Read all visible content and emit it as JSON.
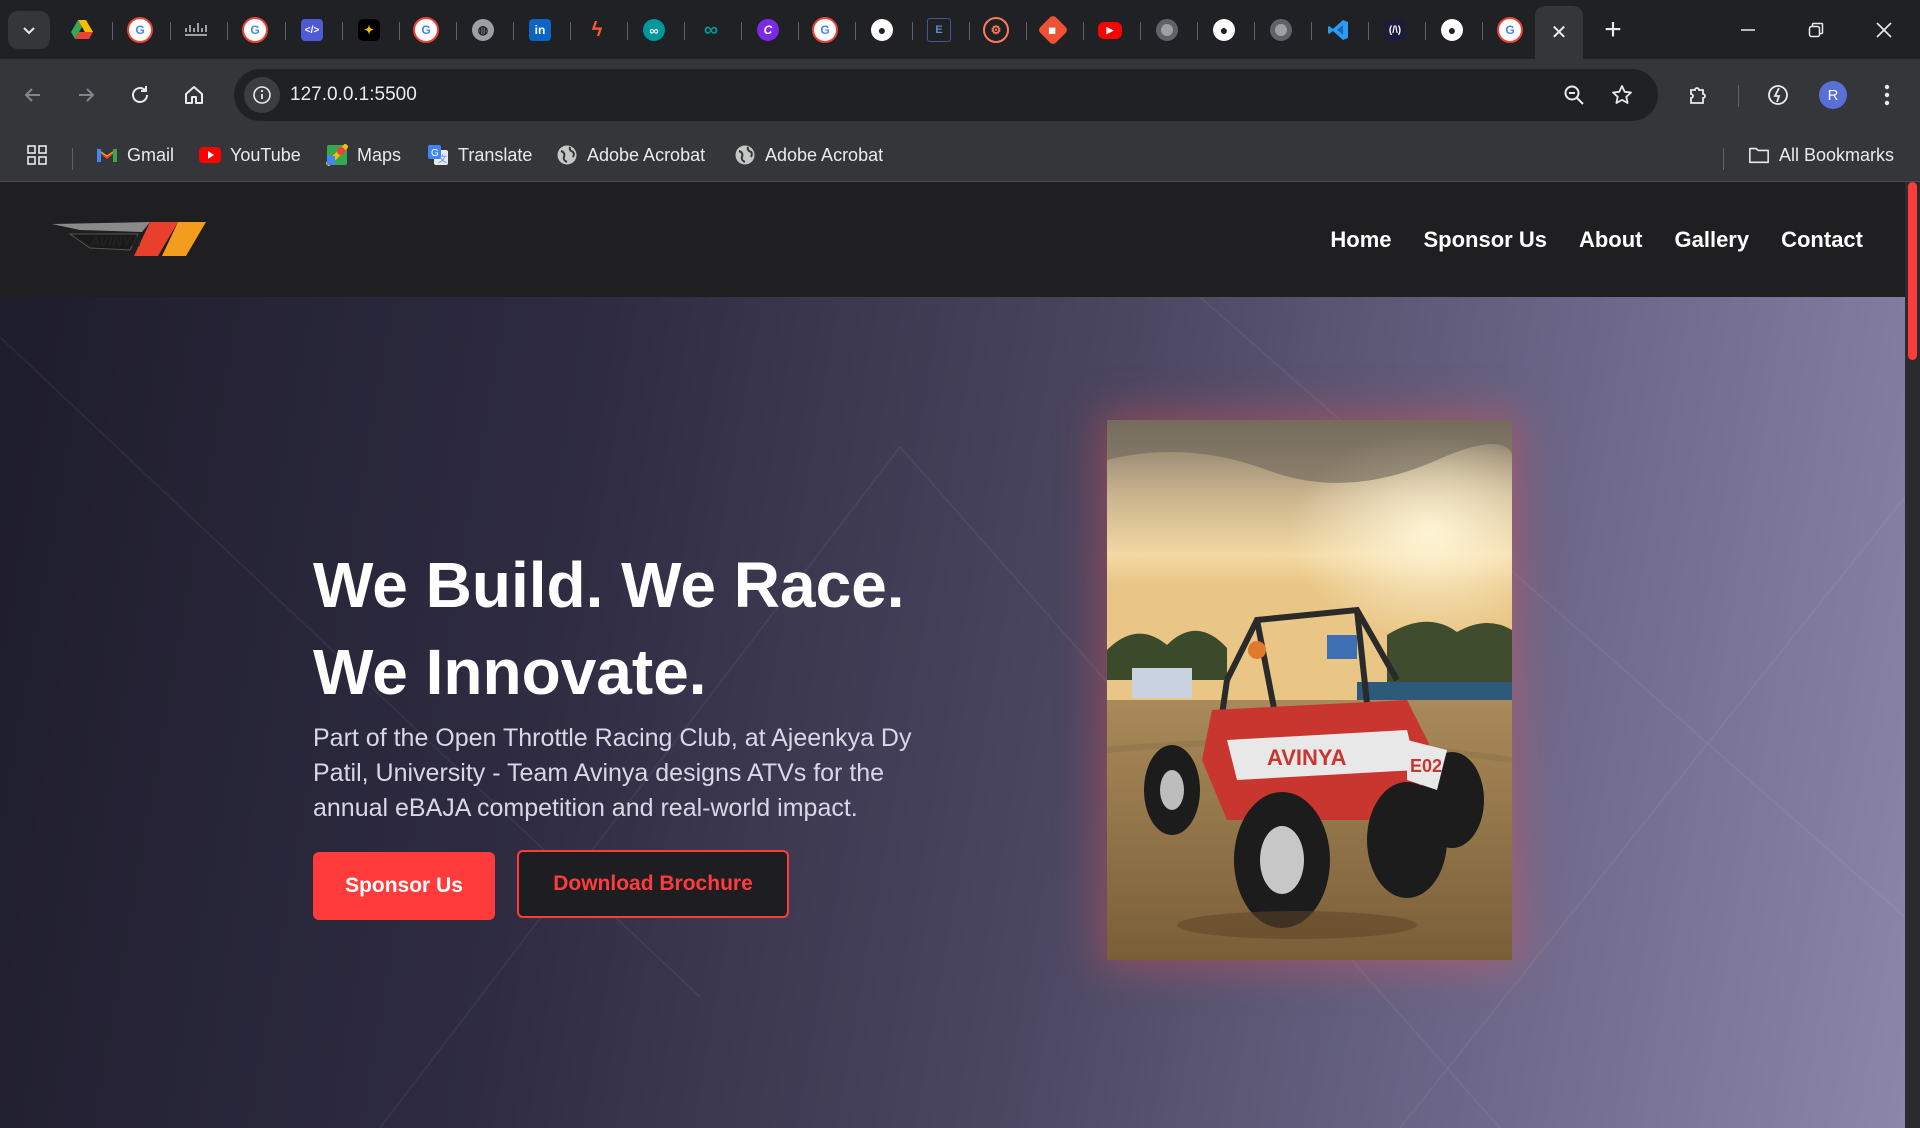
{
  "browser": {
    "tab_favicons": [
      "google-drive-icon",
      "google-icon",
      "cisco-icon",
      "google-icon",
      "code-icon",
      "fire-icon",
      "google-icon",
      "globe-icon",
      "linkedin-icon",
      "bolt-icon",
      "arduino-icon",
      "arduino-icon",
      "canva-icon",
      "google-icon",
      "github-icon",
      "code-editor-icon",
      "hubspot-icon",
      "git-icon",
      "youtube-icon",
      "chrome-icon",
      "github-icon",
      "chrome-icon",
      "vscode-icon",
      "react-icon",
      "github-icon",
      "google-icon"
    ],
    "active_tab_close": "✕",
    "new_tab": "+",
    "url": "127.0.0.1:5500",
    "profile_initial": "R"
  },
  "bookmarks": {
    "items": [
      {
        "label": "Gmail",
        "icon": "gmail-icon"
      },
      {
        "label": "YouTube",
        "icon": "youtube-icon"
      },
      {
        "label": "Maps",
        "icon": "maps-icon"
      },
      {
        "label": "Translate",
        "icon": "translate-icon"
      },
      {
        "label": "Adobe Acrobat",
        "icon": "globe-icon"
      },
      {
        "label": "Adobe Acrobat",
        "icon": "globe-icon"
      }
    ],
    "all_bookmarks": "All Bookmarks"
  },
  "site": {
    "nav": [
      "Home",
      "Sponsor Us",
      "About",
      "Gallery",
      "Contact"
    ],
    "headline_line1": "We Build. We Race.",
    "headline_line2": "We Innovate.",
    "subtext": "Part of the Open Throttle Racing Club, at Ajeenkya Dy Patil, University - Team Avinya designs ATVs for the annual eBAJA competition and real-world impact.",
    "primary_cta": "Sponsor Us",
    "secondary_cta": "Download Brochure"
  },
  "colors": {
    "accent": "#ff3b3b",
    "header_bg": "#1f1f21",
    "browser_bg": "#202124",
    "toolbar_bg": "#35363a"
  }
}
